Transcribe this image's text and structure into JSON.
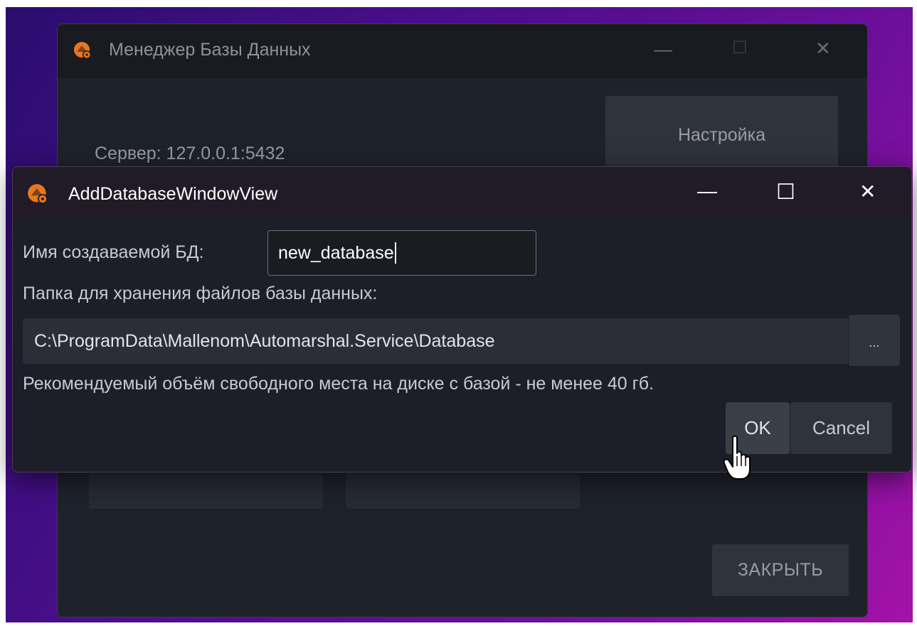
{
  "main_window": {
    "title": "Менеджер Базы Данных",
    "server_label": "Сервер: 127.0.0.1:5432",
    "settings_button": "Настройка",
    "close_button": "ЗАКРЫТЬ"
  },
  "dialog": {
    "title": "AddDatabaseWindowView",
    "db_name_label": "Имя создаваемой БД:",
    "db_name_value": "new_database",
    "folder_label": "Папка для хранения файлов базы данных:",
    "folder_path": "C:\\ProgramData\\Mallenom\\Automarshal.Service\\Database",
    "browse_button": "...",
    "recommendation": "Рекомендуемый объём свободного места на диске с базой - не менее 40 гб.",
    "ok_button": "OK",
    "cancel_button": "Cancel"
  },
  "window_controls": {
    "minimize_glyph": "—",
    "maximize_glyph": "☐",
    "close_glyph": "✕"
  },
  "colors": {
    "app_icon": "#e8781e",
    "background_start": "#2a0d6e",
    "background_end": "#a512a8",
    "dialog_titlebar": "#211b27"
  },
  "icons": {
    "app": "database-app-icon",
    "cursor": "hand-pointer-icon"
  }
}
